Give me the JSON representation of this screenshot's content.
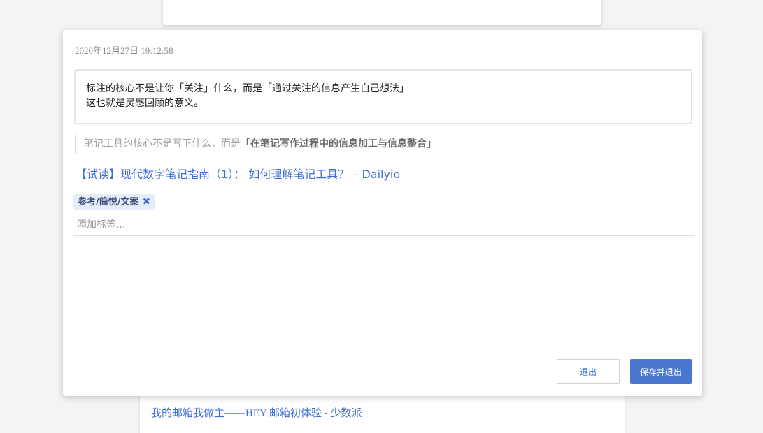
{
  "modal": {
    "timestamp": "2020年12月27日 19:12:58",
    "annotation_line1": "标注的核心不是让你「关注」什么，而是「通过关注的信息产生自己想法」",
    "annotation_line2": "这也就是灵感回顾的意义。",
    "quote_prefix": "笔记工具的核心不是写下什么，而是",
    "quote_emphasis": "「在笔记写作过程中的信息加工与信息整合」",
    "source_link": "【试读】现代数字笔记指南（1）： 如何理解笔记工具？ – Dailyio",
    "tag_label": "参考/简悦/文案",
    "tag_remove_glyph": "✖",
    "tag_input_placeholder": "添加标签...",
    "tag_input_value": "",
    "exit_button": "退出",
    "save_button": "保存并退出"
  },
  "background": {
    "bottom_card_link": "我的邮箱我做主——HEY 邮箱初体验 - 少数派"
  },
  "colors": {
    "link": "#3f6fd6",
    "primary_button": "#4a76cf",
    "tag_background": "#e6ecfa"
  }
}
